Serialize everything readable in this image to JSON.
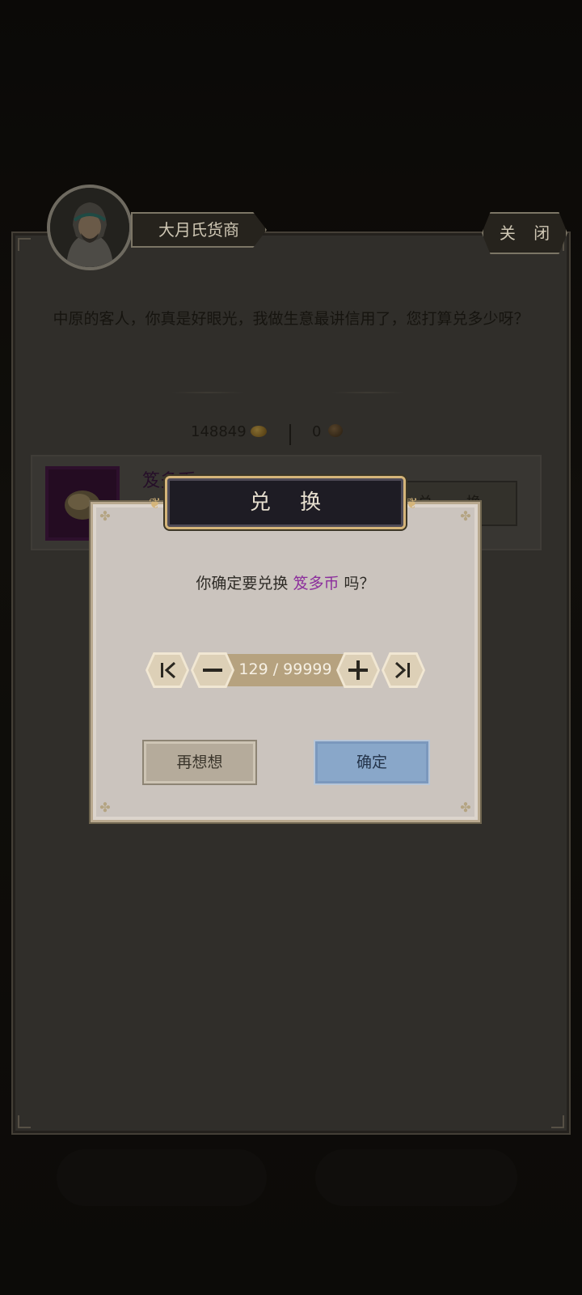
{
  "merchant": {
    "name": "大月氏货商",
    "close_label": "关 闭",
    "dialogue": "中原的客人，你真是好眼光，我做生意最讲信用了，您打算兑多少呀？"
  },
  "currencies": [
    {
      "amount": "148849",
      "icon": "gold-ingot-icon"
    },
    {
      "amount": "0",
      "icon": "coin-pouch-icon"
    }
  ],
  "shop_item": {
    "name_peek": "笈多币",
    "buy_label_peek": "兑 换"
  },
  "modal": {
    "title": "兑 换",
    "question_prefix": "你确定要兑换",
    "item_name": "笈多币",
    "question_suffix": "吗？",
    "quantity": "129 / 99999",
    "btn_min": "K",
    "btn_minus": "−",
    "btn_plus": "+",
    "btn_max": "≻I",
    "cancel_label": "再想想",
    "confirm_label": "确定"
  },
  "colors": {
    "item_name_purple": "#8b2d9c",
    "confirm_blue": "#89a7c9",
    "title_gold": "#d5b57a"
  }
}
